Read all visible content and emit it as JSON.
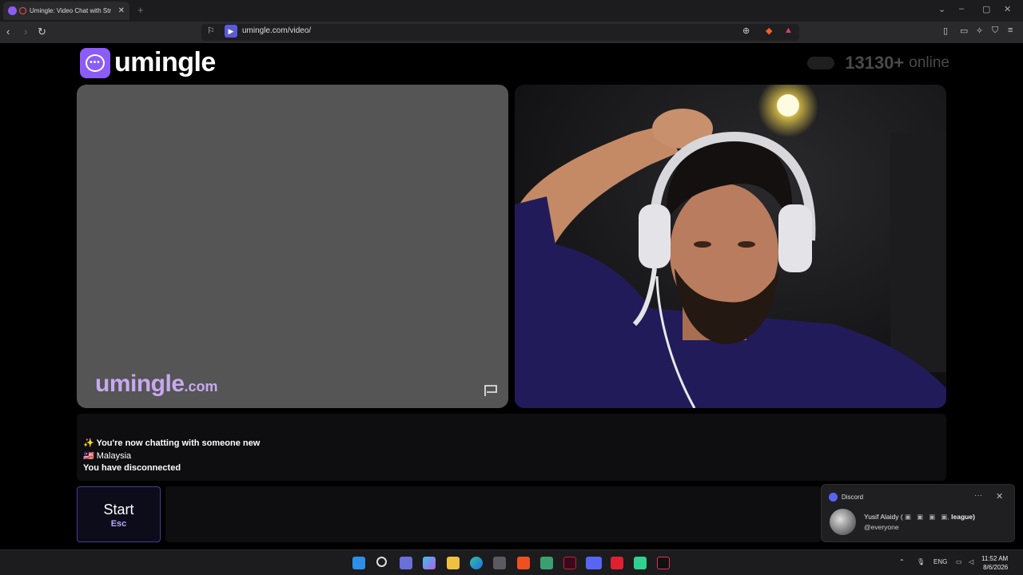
{
  "browser": {
    "tab_title": "Umingle: Video Chat with Str",
    "new_tab": "+",
    "url": "umingle.com/video/"
  },
  "page": {
    "logo_text": "umingle",
    "online_count": "13130+",
    "online_label": "online",
    "watermark_main": "umingle",
    "watermark_domain": ".com"
  },
  "chat": {
    "line1_icon": "✨",
    "line1": "You're now chatting with someone new",
    "line2_flag": "🇲🇾",
    "line2": "Malaysia",
    "line3": "You have disconnected"
  },
  "controls": {
    "start_label": "Start",
    "start_key": "Esc"
  },
  "notification": {
    "app": "Discord",
    "sender": "Yusif Alaidy (",
    "sender_tail": "league)",
    "mention": "@everyone",
    "more": "···",
    "close": "✕"
  },
  "taskbar": {
    "lang": "ENG",
    "time": "11:52 AM",
    "date": "8/6/2026"
  },
  "colors": {
    "brand": "#8b5cf6",
    "watermark": "#c8a8f0",
    "start_border": "#4a3a9a"
  }
}
